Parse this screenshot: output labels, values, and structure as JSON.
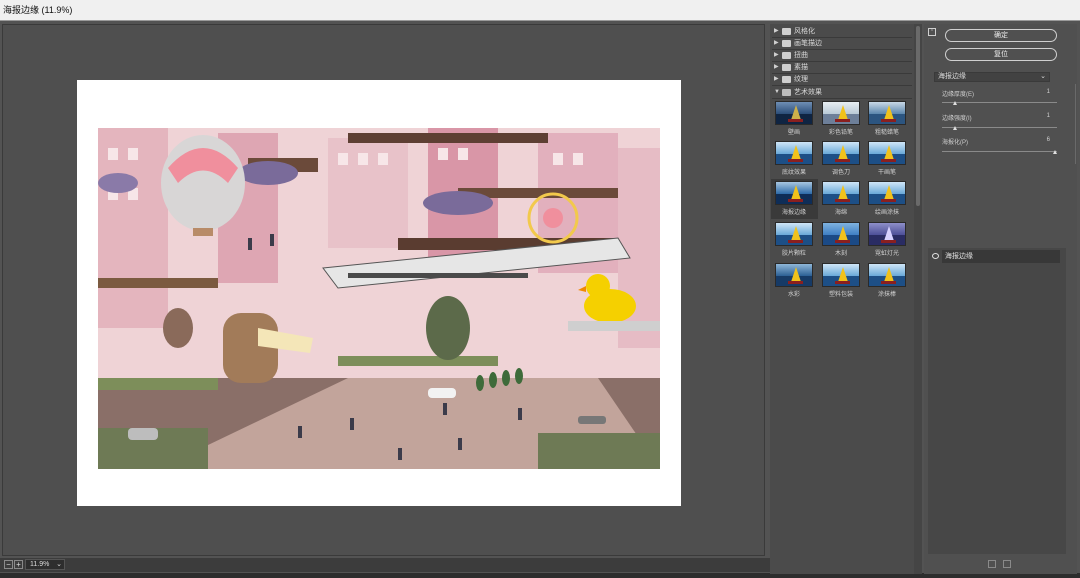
{
  "window": {
    "title": "海报边缘 (11.9%)"
  },
  "statusbar": {
    "zoom": "11.9%",
    "minus": "−",
    "plus": "+",
    "caret": "⌄"
  },
  "gallery": {
    "folders": [
      {
        "label": "风格化",
        "open": false
      },
      {
        "label": "画笔描边",
        "open": false
      },
      {
        "label": "扭曲",
        "open": false
      },
      {
        "label": "素描",
        "open": false
      },
      {
        "label": "纹理",
        "open": false
      },
      {
        "label": "艺术效果",
        "open": true
      }
    ],
    "filters": [
      "壁画",
      "彩色铅笔",
      "粗糙蜡笔",
      "底纹效果",
      "调色刀",
      "干画笔",
      "海报边缘",
      "海绵",
      "绘画涂抹",
      "胶片颗粒",
      "木刻",
      "霓虹灯光",
      "水彩",
      "塑料包装",
      "涂抹棒"
    ],
    "selected": "海报边缘",
    "triangle_closed": "▶",
    "triangle_open": "▼"
  },
  "buttons": {
    "ok": "确定",
    "reset": "复位",
    "toggle": "⌃"
  },
  "filter_select": {
    "value": "海报边缘",
    "caret": "⌄"
  },
  "params": [
    {
      "label": "边缘厚度(E)",
      "value": "1",
      "fraction": 0.1
    },
    {
      "label": "边缘强度(I)",
      "value": "1",
      "fraction": 0.1
    },
    {
      "label": "海报化(P)",
      "value": "6",
      "fraction": 1.0
    }
  ],
  "layers": [
    {
      "name": "海报边缘"
    }
  ],
  "colors": {
    "accent": "#f1c21b",
    "panel": "#505050",
    "dialog": "#535353"
  }
}
